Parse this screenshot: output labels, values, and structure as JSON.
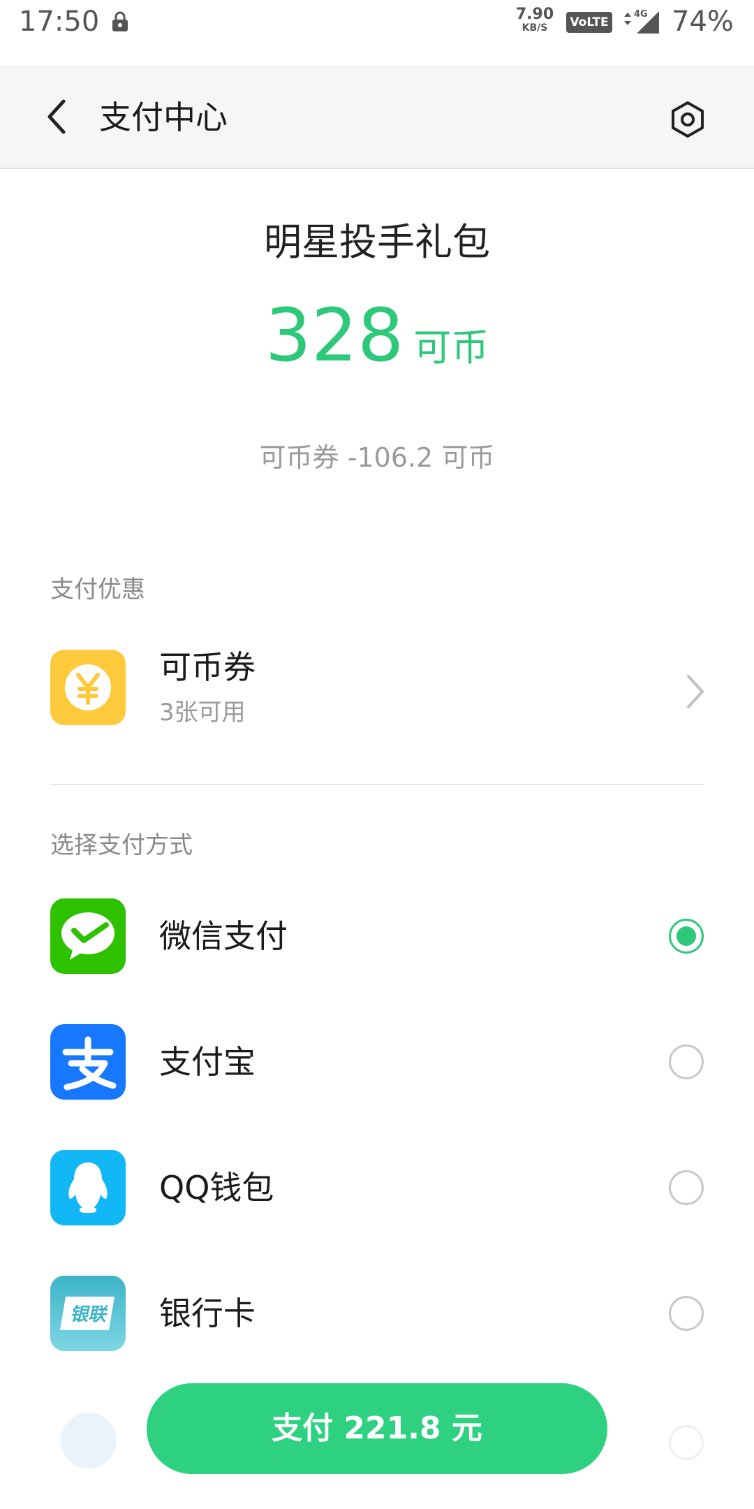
{
  "status_bar": {
    "time": "17:50",
    "net_speed_value": "7.90",
    "net_speed_unit": "KB/S",
    "volte": "VoLTE",
    "network": "4G",
    "battery": "74%"
  },
  "app_bar": {
    "title": "支付中心",
    "back_icon": "chevron-left-icon",
    "settings_icon": "hexagon-settings-icon"
  },
  "product": {
    "name": "明星投手礼包",
    "price_amount": "328",
    "price_unit": "可币",
    "coupon_deduction": "可币券 -106.2 可币"
  },
  "discount_section": {
    "label": "支付优惠",
    "coupon_title": "可币券",
    "coupon_sub": "3张可用",
    "coupon_icon": "yuan-coin-icon"
  },
  "payment_section": {
    "label": "选择支付方式",
    "methods": [
      {
        "name": "微信支付",
        "icon": "wechat-pay-icon",
        "selected": true
      },
      {
        "name": "支付宝",
        "icon": "alipay-icon",
        "selected": false
      },
      {
        "name": "QQ钱包",
        "icon": "qq-wallet-icon",
        "selected": false
      },
      {
        "name": "银行卡",
        "icon": "unionpay-icon",
        "icon_text": "银联",
        "selected": false
      }
    ]
  },
  "pay_button": {
    "label": "支付 221.8 元"
  },
  "colors": {
    "accent": "#2dc87a",
    "pay_button": "#2dd17f",
    "wechat": "#2dc100",
    "alipay": "#1677ff",
    "qq": "#12b7f5",
    "unionpay": "#3cb4c8",
    "coupon": "#ffc93c"
  }
}
